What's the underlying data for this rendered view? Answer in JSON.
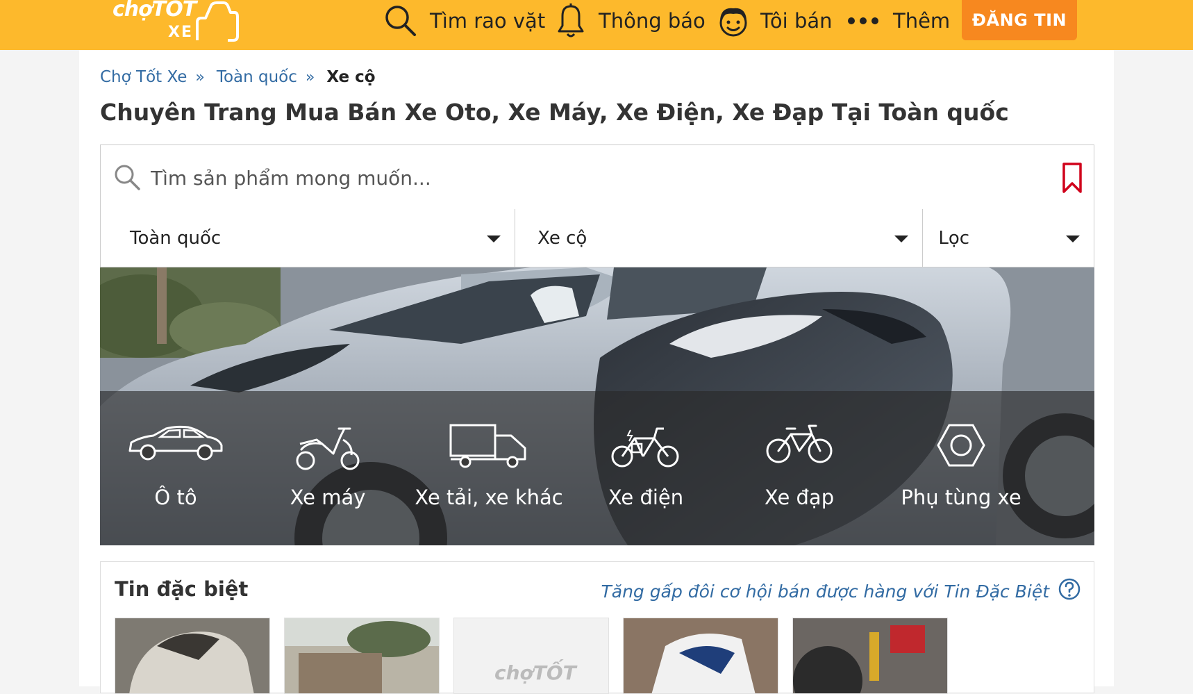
{
  "header": {
    "logo_main": "chợTỐT",
    "logo_sub": "XE",
    "nav": [
      {
        "label": "Tìm rao vặt",
        "icon": "search-icon"
      },
      {
        "label": "Thông báo",
        "icon": "bell-icon"
      },
      {
        "label": "Tôi bán",
        "icon": "seller-face-icon"
      },
      {
        "label": "Thêm",
        "icon": "more-dots-icon"
      }
    ],
    "post_button": "ĐĂNG TIN",
    "brand_color": "#fdb92c",
    "post_color": "#f7881f"
  },
  "breadcrumb": {
    "items": [
      "Chợ Tốt Xe",
      "Toàn quốc"
    ],
    "current": "Xe cộ",
    "separator": "»"
  },
  "page_title": "Chuyên Trang Mua Bán Xe Oto, Xe Máy, Xe Điện, Xe Đạp Tại Toàn quốc",
  "search": {
    "placeholder": "Tìm sản phẩm mong muốn...",
    "value": ""
  },
  "filters": [
    {
      "label": "Toàn quốc"
    },
    {
      "label": "Xe cộ"
    },
    {
      "label": "Lọc"
    }
  ],
  "categories": [
    {
      "label": "Ô tô",
      "icon": "car-icon"
    },
    {
      "label": "Xe máy",
      "icon": "motorbike-icon"
    },
    {
      "label": "Xe tải, xe khác",
      "icon": "truck-icon"
    },
    {
      "label": "Xe điện",
      "icon": "electric-bike-icon"
    },
    {
      "label": "Xe đạp",
      "icon": "bicycle-icon"
    },
    {
      "label": "Phụ tùng xe",
      "icon": "hex-nut-icon"
    }
  ],
  "special": {
    "title": "Tin đặc biệt",
    "promo": "Tăng gấp đôi cơ hội bán được hàng với Tin Đặc Biệt",
    "placeholder_logo": "chợTỐT"
  }
}
